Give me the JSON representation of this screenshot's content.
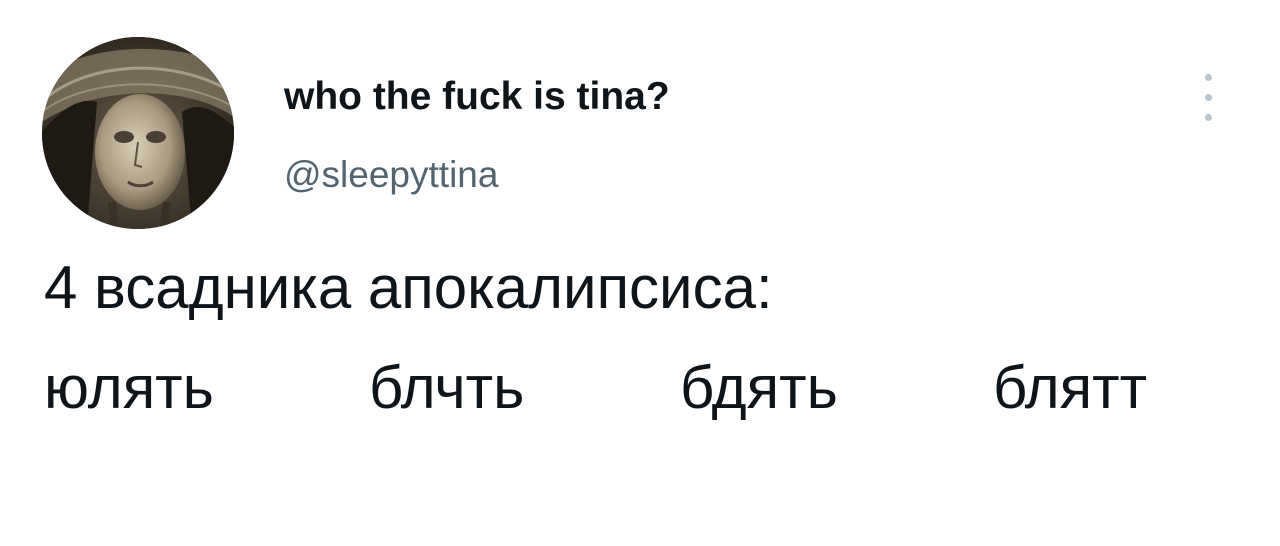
{
  "tweet": {
    "display_name": "who the fuck is tina?",
    "handle": "@sleepyttina",
    "text_line1": "4 всадника апокалипсиса:",
    "text_line2_words": [
      "юлять",
      "блчть",
      "бдять",
      "блятт"
    ]
  },
  "icons": {
    "more": "vertical-ellipsis-icon",
    "avatar": "avatar-image"
  },
  "colors": {
    "name": "#0f1419",
    "handle": "#536471",
    "more_dots": "#b9c4cc",
    "background": "#ffffff"
  }
}
